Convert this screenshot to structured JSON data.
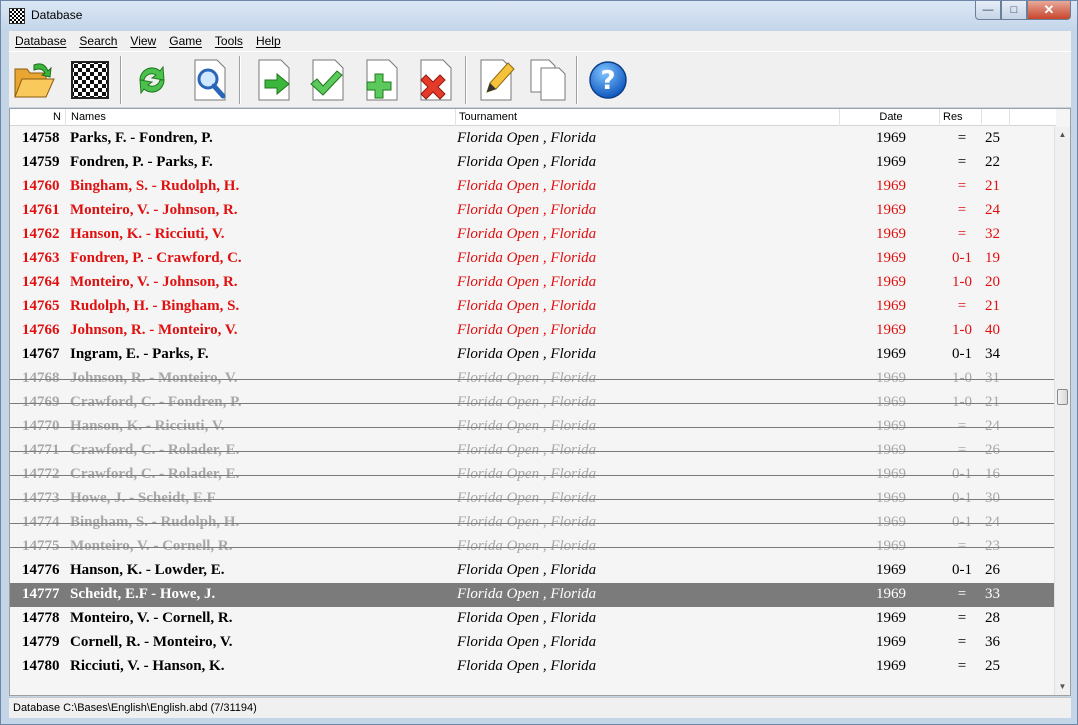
{
  "window": {
    "title": "Database"
  },
  "menu": [
    "Database",
    "Search",
    "View",
    "Game",
    "Tools",
    "Help"
  ],
  "toolbar": {
    "buttons": [
      "open-folder-icon",
      "chessboard-icon",
      "refresh-icon",
      "search-icon",
      "export-icon",
      "check-icon",
      "add-icon",
      "delete-icon",
      "edit-icon",
      "copy-icon",
      "help-icon"
    ],
    "help_label": "?"
  },
  "columns": {
    "n": "N",
    "names": "Names",
    "tournament": "Tournament",
    "date": "Date",
    "res": "Res"
  },
  "rows": [
    {
      "n": "14758",
      "names": "Parks, F. - Fondren, P.",
      "tournament": "Florida Open , Florida",
      "date": "1969",
      "res": "=",
      "moves": "25",
      "state": "normal"
    },
    {
      "n": "14759",
      "names": "Fondren, P. - Parks, F.",
      "tournament": "Florida Open , Florida",
      "date": "1969",
      "res": "=",
      "moves": "22",
      "state": "normal"
    },
    {
      "n": "14760",
      "names": "Bingham, S. - Rudolph, H.",
      "tournament": "Florida Open , Florida",
      "date": "1969",
      "res": "=",
      "moves": "21",
      "state": "red"
    },
    {
      "n": "14761",
      "names": "Monteiro, V. - Johnson, R.",
      "tournament": "Florida Open , Florida",
      "date": "1969",
      "res": "=",
      "moves": "24",
      "state": "red"
    },
    {
      "n": "14762",
      "names": "Hanson, K. - Ricciuti, V.",
      "tournament": "Florida Open , Florida",
      "date": "1969",
      "res": "=",
      "moves": "32",
      "state": "red"
    },
    {
      "n": "14763",
      "names": "Fondren, P. - Crawford, C.",
      "tournament": "Florida Open , Florida",
      "date": "1969",
      "res": "0-1",
      "moves": "19",
      "state": "red"
    },
    {
      "n": "14764",
      "names": "Monteiro, V. - Johnson, R.",
      "tournament": "Florida Open , Florida",
      "date": "1969",
      "res": "1-0",
      "moves": "20",
      "state": "red"
    },
    {
      "n": "14765",
      "names": "Rudolph, H. - Bingham, S.",
      "tournament": "Florida Open , Florida",
      "date": "1969",
      "res": "=",
      "moves": "21",
      "state": "red"
    },
    {
      "n": "14766",
      "names": "Johnson, R. - Monteiro, V.",
      "tournament": "Florida Open , Florida",
      "date": "1969",
      "res": "1-0",
      "moves": "40",
      "state": "red"
    },
    {
      "n": "14767",
      "names": "Ingram, E. - Parks, F.",
      "tournament": "Florida Open , Florida",
      "date": "1969",
      "res": "0-1",
      "moves": "34",
      "state": "normal"
    },
    {
      "n": "14768",
      "names": "Johnson, R. - Monteiro, V.",
      "tournament": "Florida Open , Florida",
      "date": "1969",
      "res": "1-0",
      "moves": "31",
      "state": "grey"
    },
    {
      "n": "14769",
      "names": "Crawford, C. - Fondren, P.",
      "tournament": "Florida Open , Florida",
      "date": "1969",
      "res": "1-0",
      "moves": "21",
      "state": "grey"
    },
    {
      "n": "14770",
      "names": "Hanson, K. - Ricciuti, V.",
      "tournament": "Florida Open , Florida",
      "date": "1969",
      "res": "=",
      "moves": "24",
      "state": "grey"
    },
    {
      "n": "14771",
      "names": "Crawford, C. - Rolader, E.",
      "tournament": "Florida Open , Florida",
      "date": "1969",
      "res": "=",
      "moves": "26",
      "state": "grey"
    },
    {
      "n": "14772",
      "names": "Crawford, C. - Rolader, E.",
      "tournament": "Florida Open , Florida",
      "date": "1969",
      "res": "0-1",
      "moves": "16",
      "state": "grey"
    },
    {
      "n": "14773",
      "names": "Howe, J. - Scheidt, E.F",
      "tournament": "Florida Open , Florida",
      "date": "1969",
      "res": "0-1",
      "moves": "30",
      "state": "grey"
    },
    {
      "n": "14774",
      "names": "Bingham, S. - Rudolph, H.",
      "tournament": "Florida Open , Florida",
      "date": "1969",
      "res": "0-1",
      "moves": "24",
      "state": "grey"
    },
    {
      "n": "14775",
      "names": "Monteiro, V. - Cornell, R.",
      "tournament": "Florida Open , Florida",
      "date": "1969",
      "res": "=",
      "moves": "23",
      "state": "grey"
    },
    {
      "n": "14776",
      "names": "Hanson, K. - Lowder, E.",
      "tournament": "Florida Open , Florida",
      "date": "1969",
      "res": "0-1",
      "moves": "26",
      "state": "normal"
    },
    {
      "n": "14777",
      "names": "Scheidt, E.F - Howe, J.",
      "tournament": "Florida Open , Florida",
      "date": "1969",
      "res": "=",
      "moves": "33",
      "state": "sel"
    },
    {
      "n": "14778",
      "names": "Monteiro, V. - Cornell, R.",
      "tournament": "Florida Open , Florida",
      "date": "1969",
      "res": "=",
      "moves": "28",
      "state": "normal"
    },
    {
      "n": "14779",
      "names": "Cornell, R. - Monteiro, V.",
      "tournament": "Florida Open , Florida",
      "date": "1969",
      "res": "=",
      "moves": "36",
      "state": "normal"
    },
    {
      "n": "14780",
      "names": "Ricciuti, V. - Hanson, K.",
      "tournament": "Florida Open , Florida",
      "date": "1969",
      "res": "=",
      "moves": "25",
      "state": "normal"
    }
  ],
  "status": "Database C:\\Bases\\English\\English.abd (7/31194)",
  "colors": {
    "red": "#e01010",
    "grey": "#a8a8a8",
    "selected": "#7b7b7b"
  }
}
